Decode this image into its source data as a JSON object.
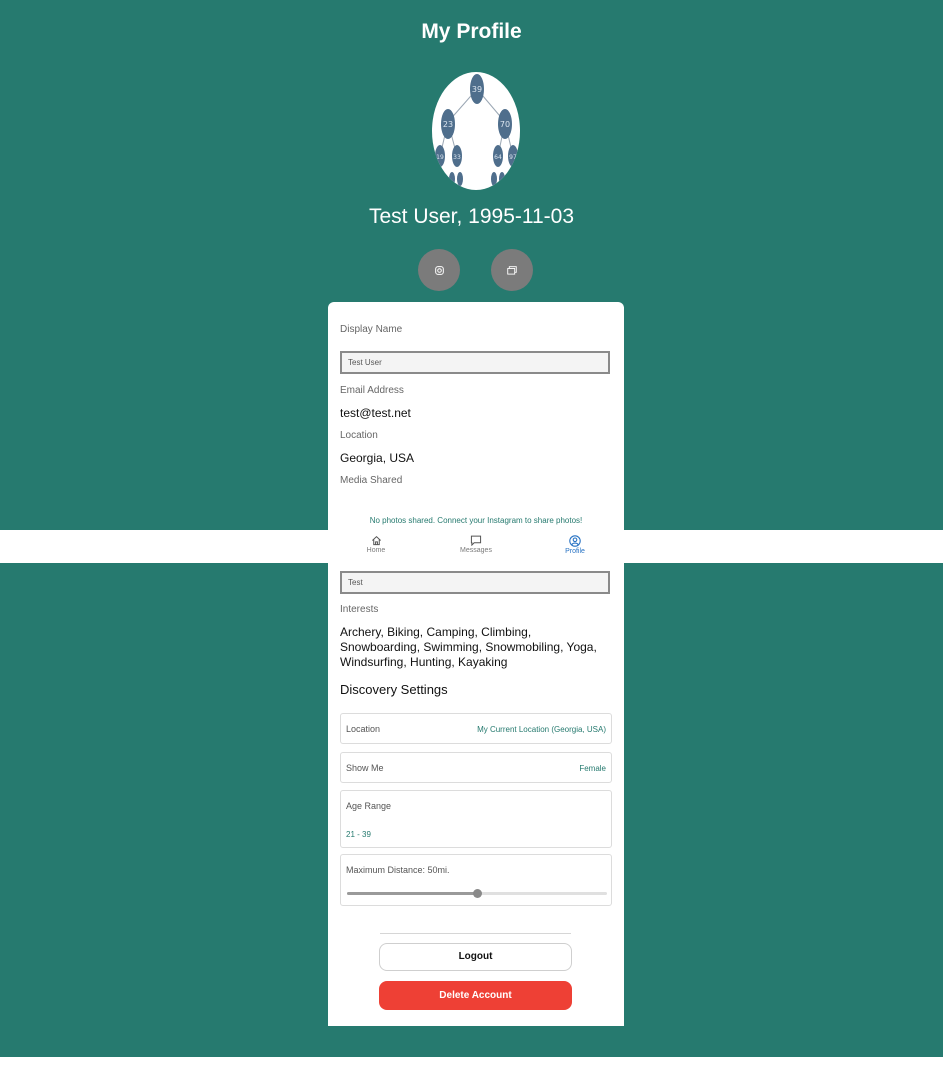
{
  "colors": {
    "teal": "#267a6f",
    "accent_blue": "#2a74c4",
    "danger": "#ee4035"
  },
  "header": {
    "title": "My Profile"
  },
  "profile": {
    "name_dob": "Test User, 1995-11-03"
  },
  "avatar_tree_nodes": [
    "39",
    "23",
    "70",
    "19",
    "33",
    "64",
    "97"
  ],
  "social": {
    "instagram_icon": "instagram-icon",
    "gallery_icon": "photos-icon"
  },
  "form": {
    "display_name_label": "Display Name",
    "display_name_value": "Test User",
    "email_label": "Email Address",
    "email_value": "test@test.net",
    "location_label": "Location",
    "location_value": "Georgia, USA",
    "media_label": "Media Shared",
    "no_photos_text": "No photos shared. Connect your Instagram to share photos!",
    "bio_value": "Test",
    "interests_label": "Interests",
    "interests_value": "Archery, Biking, Camping, Climbing, Snowboarding, Swimming, Snowmobiling, Yoga, Windsurfing, Hunting, Kayaking"
  },
  "tabbar": {
    "home": "Home",
    "messages": "Messages",
    "profile": "Profile",
    "active": "profile"
  },
  "discovery": {
    "title": "Discovery Settings",
    "location_label": "Location",
    "location_value": "My Current Location (Georgia, USA)",
    "show_me_label": "Show Me",
    "show_me_value": "Female",
    "age_range_label": "Age Range",
    "age_range_value": "21 - 39",
    "distance_label": "Maximum Distance: 50mi.",
    "distance_fraction": 0.5
  },
  "actions": {
    "logout": "Logout",
    "delete": "Delete Account"
  }
}
